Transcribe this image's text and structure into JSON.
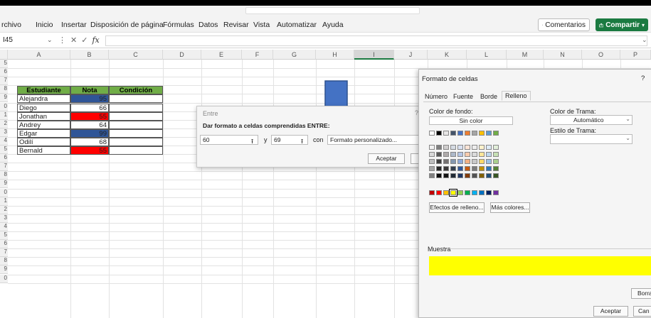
{
  "accent": {
    "excel_green": "#1b7a41",
    "header_fill": "#70ad47",
    "blue_fill": "#2f5597",
    "red_fill": "#ff0000",
    "yellow": "#ffff00",
    "arrow": "#4472c4"
  },
  "menu": [
    "rchivo",
    "Inicio",
    "Insertar",
    "Disposición de página",
    "Fórmulas",
    "Datos",
    "Revisar",
    "Vista",
    "Automatizar",
    "Ayuda"
  ],
  "buttons": {
    "comments": "Comentarios",
    "share": "Compartir",
    "comments_icon": "comment-icon",
    "share_icon": "share-icon"
  },
  "formula": {
    "namebox": "I45",
    "fx": "fx",
    "value": ""
  },
  "columns": [
    "A",
    "B",
    "C",
    "D",
    "E",
    "F",
    "G",
    "H",
    "I",
    "J",
    "K",
    "L",
    "M",
    "N",
    "O",
    "P"
  ],
  "rows": [
    "5",
    "6",
    "7",
    "8",
    "9",
    "0",
    "1",
    "2",
    "3",
    "4",
    "5",
    "6",
    "7",
    "8",
    "9",
    "0",
    "1",
    "2",
    "3",
    "4",
    "5",
    "6",
    "7",
    "8",
    "9",
    "0"
  ],
  "table": {
    "headers": [
      "Estudiante",
      "Nota",
      "Condición"
    ],
    "rows": [
      {
        "name": "Alejandra",
        "nota": "95",
        "fill": "#2f5597"
      },
      {
        "name": "Diego",
        "nota": "66",
        "fill": "#ffffff"
      },
      {
        "name": "Jonathan",
        "nota": "55",
        "fill": "#ff0000"
      },
      {
        "name": "Andrey",
        "nota": "64",
        "fill": "#ffffff"
      },
      {
        "name": "Edgar",
        "nota": "99",
        "fill": "#2f5597"
      },
      {
        "name": "Odilí",
        "nota": "68",
        "fill": "#ffffff"
      },
      {
        "name": "Bernald",
        "nota": "55",
        "fill": "#ff0000"
      }
    ]
  },
  "entre": {
    "title": "Entre",
    "help": "?",
    "prompt": "Dar formato a celdas comprendidas ENTRE:",
    "from": "60",
    "and": "y",
    "to": "69",
    "with": "con",
    "format": "Formato personalizado...",
    "accept": "Aceptar"
  },
  "format_cells": {
    "title": "Formato de celdas",
    "help": "?",
    "tabs": [
      "Número",
      "Fuente",
      "Borde",
      "Relleno"
    ],
    "active_tab": "Relleno",
    "bg_label": "Color de fondo:",
    "no_color": "Sin color",
    "pattern_color_label": "Color de Trama:",
    "pattern_color_value": "Automático",
    "pattern_style_label": "Estilo de Trama:",
    "effects": "Efectos de relleno...",
    "more_colors": "Más colores...",
    "sample_label": "Muestra",
    "sample_color": "#ffff00",
    "clear": "Borra",
    "accept": "Aceptar",
    "cancel": "Can",
    "theme_colors": [
      [
        "#ffffff",
        "#000000",
        "#e7e6e6",
        "#44546a",
        "#4472c4",
        "#ed7d31",
        "#a5a5a5",
        "#ffc000",
        "#5b9bd5",
        "#70ad47"
      ],
      [
        "#f2f2f2",
        "#7f7f7f",
        "#d0cece",
        "#d6dce4",
        "#d9e1f2",
        "#fce4d6",
        "#ededed",
        "#fff2cc",
        "#ddebf7",
        "#e2efda"
      ],
      [
        "#d9d9d9",
        "#595959",
        "#aeaaaa",
        "#adb9ca",
        "#b4c6e7",
        "#f8cbad",
        "#dbdbdb",
        "#ffe699",
        "#bdd7ee",
        "#c6e0b4"
      ],
      [
        "#bfbfbf",
        "#3f3f3f",
        "#757171",
        "#8497b0",
        "#8ea9db",
        "#f4b084",
        "#c9c9c9",
        "#ffd966",
        "#9bc2e6",
        "#a9d08e"
      ],
      [
        "#a6a6a6",
        "#262626",
        "#3a3838",
        "#333f4f",
        "#2f5597",
        "#c65911",
        "#7b7b7b",
        "#bf8f00",
        "#2e75b6",
        "#548235"
      ],
      [
        "#808080",
        "#0d0d0d",
        "#161616",
        "#222b35",
        "#203764",
        "#833c0c",
        "#525252",
        "#806000",
        "#1f4e78",
        "#375623"
      ]
    ],
    "standard_colors": [
      "#c00000",
      "#ff0000",
      "#ffc000",
      "#ffff00",
      "#92d050",
      "#00b050",
      "#00b0f0",
      "#0070c0",
      "#002060",
      "#7030a0"
    ],
    "selected_standard": 3
  }
}
